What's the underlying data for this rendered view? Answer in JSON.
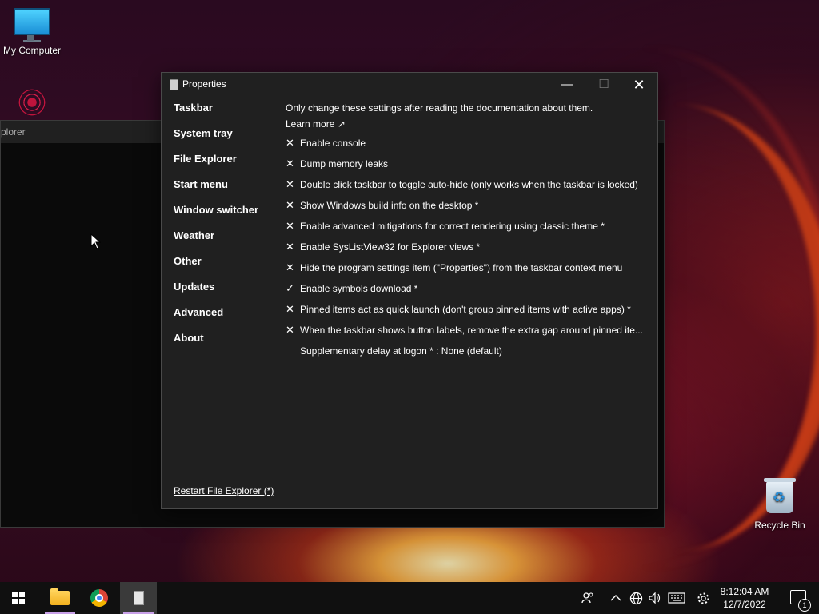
{
  "desktop": {
    "icons": [
      {
        "label": "My Computer"
      },
      {
        "label": ""
      },
      {
        "label": "Recycle Bin"
      }
    ]
  },
  "explorer": {
    "title": "plorer"
  },
  "properties": {
    "title": "Properties",
    "nav": [
      {
        "label": "Taskbar"
      },
      {
        "label": "System tray"
      },
      {
        "label": "File Explorer"
      },
      {
        "label": "Start menu"
      },
      {
        "label": "Window switcher"
      },
      {
        "label": "Weather"
      },
      {
        "label": "Other"
      },
      {
        "label": "Updates"
      },
      {
        "label": "Advanced"
      },
      {
        "label": "About"
      }
    ],
    "active_nav": "Advanced",
    "intro": "Only change these settings after reading the documentation about them.",
    "learn_more": "Learn more ↗",
    "options": [
      {
        "mark": "✕",
        "text": "Enable console"
      },
      {
        "mark": "✕",
        "text": "Dump memory leaks"
      },
      {
        "mark": "✕",
        "text": "Double click taskbar to toggle auto-hide (only works when the taskbar is locked)"
      },
      {
        "mark": "✕",
        "text": "Show Windows build info on the desktop *"
      },
      {
        "mark": "✕",
        "text": "Enable advanced mitigations for correct rendering using classic theme *"
      },
      {
        "mark": "✕",
        "text": "Enable SysListView32 for Explorer views *"
      },
      {
        "mark": "✕",
        "text": "Hide the program settings item (\"Properties\") from the taskbar context menu"
      },
      {
        "mark": "✓",
        "text": "Enable symbols download *"
      },
      {
        "mark": "✕",
        "text": "Pinned items act as quick launch (don't group pinned items with active apps) *"
      },
      {
        "mark": "✕",
        "text": "When the taskbar shows button labels, remove the extra gap around pinned ite..."
      }
    ],
    "delay_text": "Supplementary delay at logon * : None (default)",
    "restart_link": "Restart File Explorer (*)",
    "window_buttons": {
      "minimize": "—",
      "maximize": "☐",
      "close": "✕"
    }
  },
  "taskbar": {
    "clock_time": "8:12:04 AM",
    "clock_date": "12/7/2022",
    "notification_count": "1",
    "tray_icons": [
      "people-icon",
      "chevron-up-icon",
      "network-icon",
      "volume-icon",
      "keyboard-icon",
      "settings-icon"
    ]
  }
}
